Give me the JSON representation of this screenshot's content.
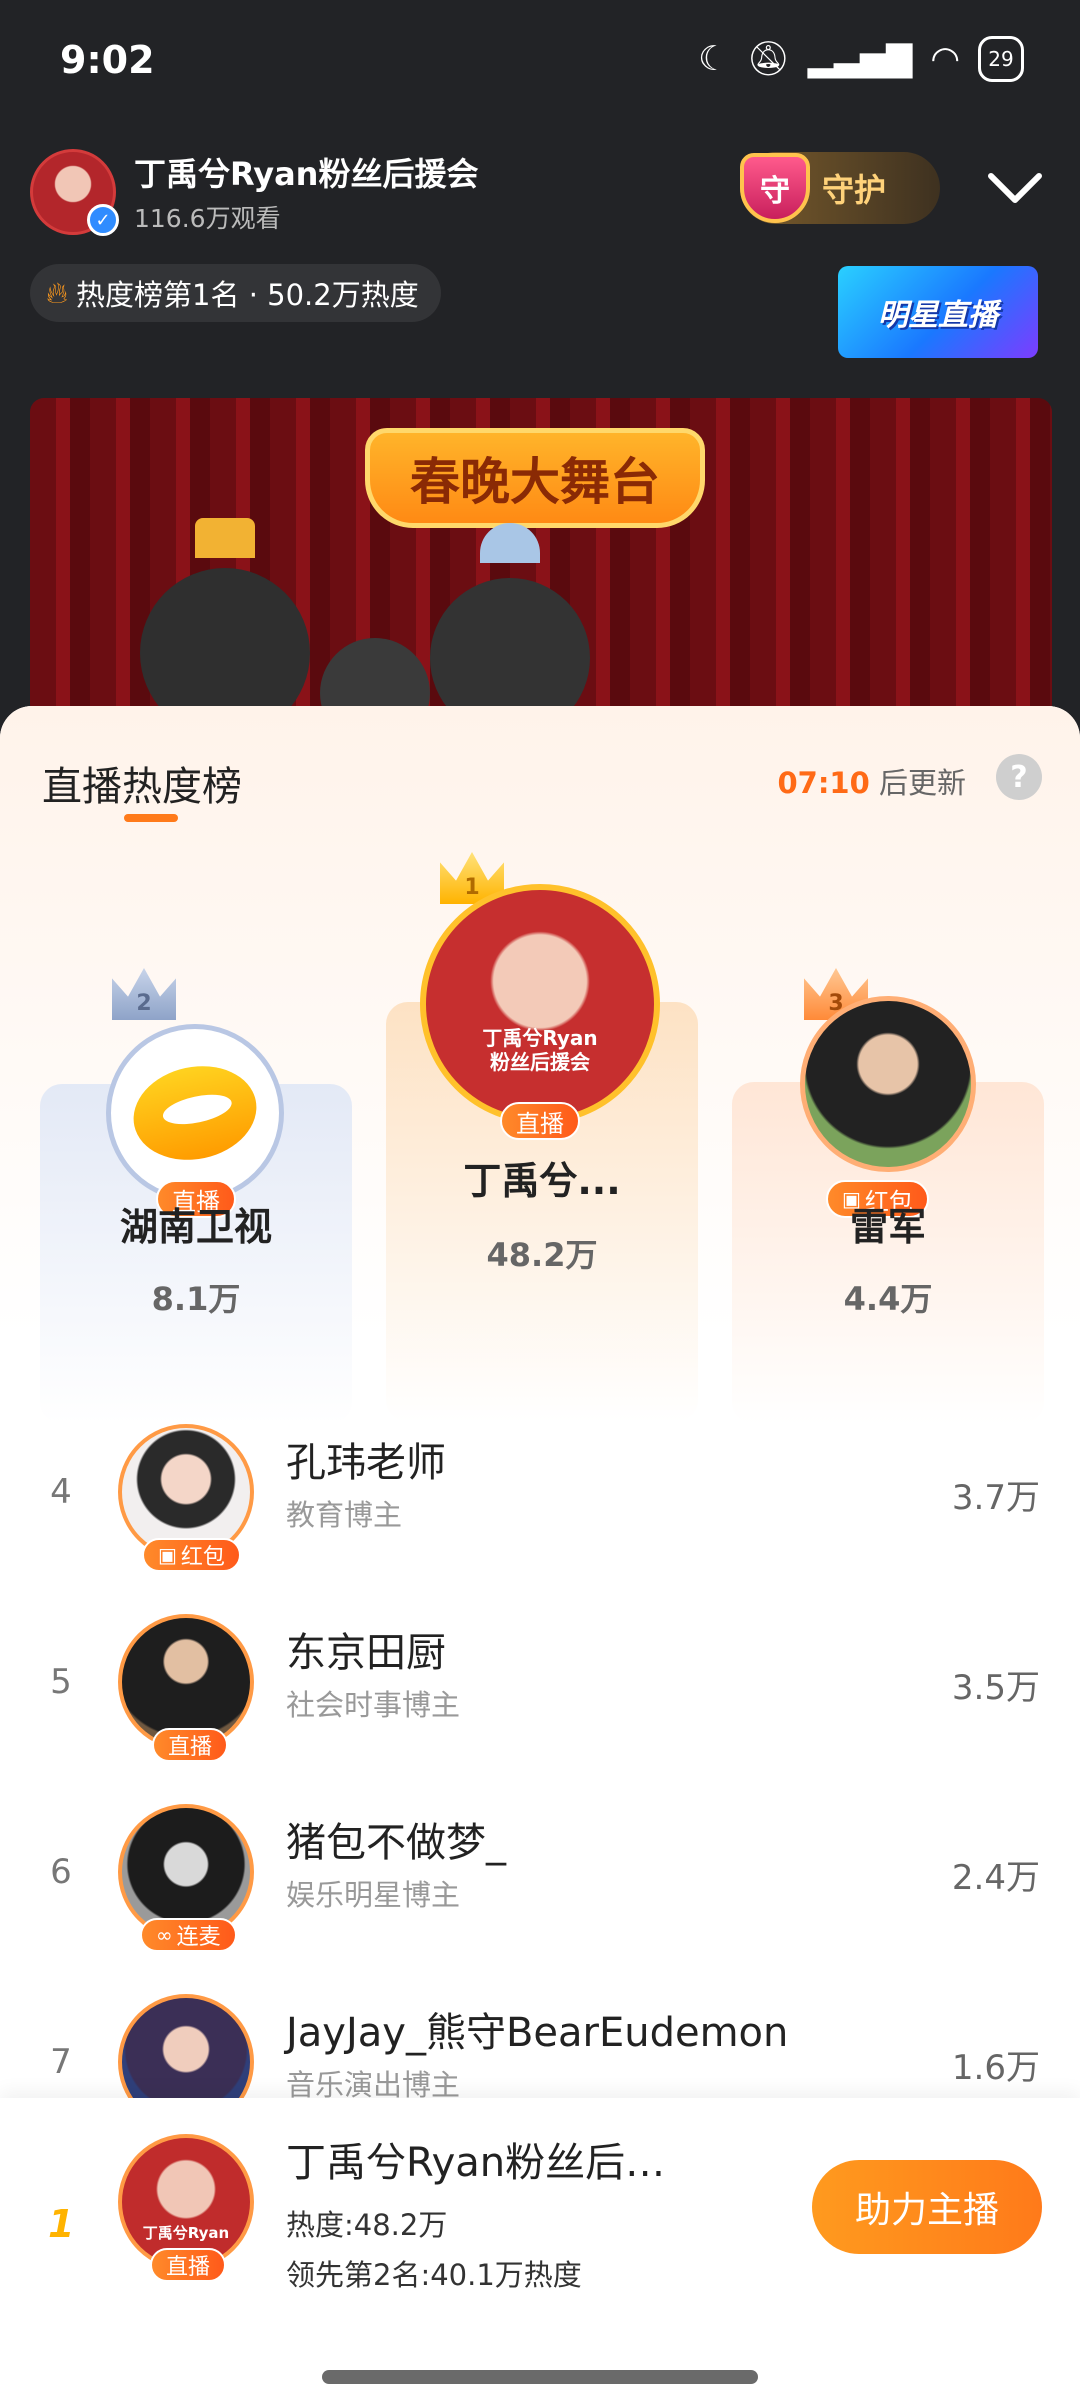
{
  "status_bar": {
    "time": "9:02",
    "icons": [
      "moon-icon",
      "mute-icon",
      "signal-icon",
      "wifi-icon",
      "rabbit-icon"
    ],
    "badge": "29"
  },
  "header": {
    "host_name": "丁禹兮Ryan粉丝后援会",
    "viewers": "116.6万观看",
    "guard_shield": "守",
    "guard_label": "守护",
    "heat_chip": "热度榜第1名 · 50.2万热度",
    "star_banner": "明星直播"
  },
  "stage": {
    "title": "春晚大舞台"
  },
  "sheet": {
    "title": "直播热度榜",
    "update_time": "07:10",
    "update_suffix": " 后更新",
    "help": "?"
  },
  "podium": [
    {
      "rank": "2",
      "name": "湖南卫视",
      "value": "8.1万",
      "tag": "直播",
      "tag_icon": ""
    },
    {
      "rank": "1",
      "name": "丁禹兮...",
      "value": "48.2万",
      "tag": "直播",
      "tag_icon": "",
      "avatar_text_1": "丁禹兮Ryan",
      "avatar_text_2": "粉丝后援会"
    },
    {
      "rank": "3",
      "name": "雷军",
      "value": "4.4万",
      "tag": "红包",
      "tag_icon": "▣"
    }
  ],
  "list": [
    {
      "rank": "4",
      "name": "孔玮老师",
      "sub": "教育博主",
      "value": "3.7万",
      "tag": "红包",
      "tag_icon": "▣"
    },
    {
      "rank": "5",
      "name": "东京田厨",
      "sub": "社会时事博主",
      "value": "3.5万",
      "tag": "直播",
      "tag_icon": ""
    },
    {
      "rank": "6",
      "name": "猪包不做梦_",
      "sub": "娱乐明星博主",
      "value": "2.4万",
      "tag": "连麦",
      "tag_icon": "∞"
    },
    {
      "rank": "7",
      "name": "JayJay_熊守BearEudemon",
      "sub": "音乐演出博主",
      "value": "1.6万"
    }
  ],
  "my_rank": {
    "rank": "1",
    "name": "丁禹兮Ryan粉丝后…",
    "heat": "热度:48.2万",
    "lead": "领先第2名:40.1万热度",
    "tag": "直播",
    "avatar_text_1": "丁禹兮Ryan",
    "boost_label": "助力主播"
  },
  "colors": {
    "accent": "#ff7a1a",
    "gold": "#ffb300",
    "background": "#222326"
  }
}
